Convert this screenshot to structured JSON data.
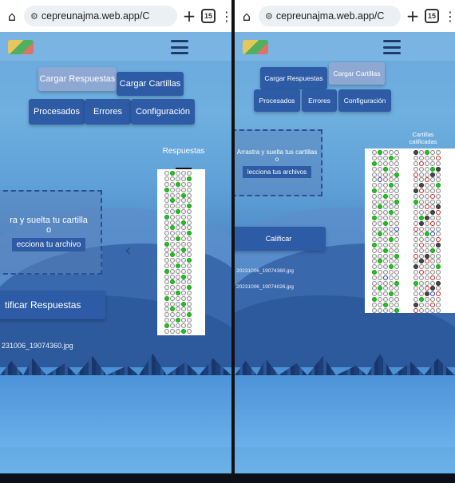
{
  "browser_left": {
    "url": "cepreunajma.web.app/C",
    "tab_count": "15"
  },
  "browser_right": {
    "url": "cepreunajma.web.app/C",
    "tab_count": "15"
  },
  "icons": {
    "home": "home-icon",
    "tune": "site-settings-icon",
    "plus": "new-tab-icon",
    "tabs": "tab-switcher-icon",
    "menu": "overflow-menu-icon",
    "hamburger": "hamburger-menu-icon"
  },
  "left": {
    "nav": {
      "cargar_respuestas": "Cargar Respuestas",
      "cargar_cartillas": "Cargar Cartillas",
      "procesados": "Procesados",
      "errores": "Errores",
      "configuracion": "Configuración"
    },
    "respuestas_title": "Respuestas",
    "dropzone": {
      "text": "ra y suelta tu cartilla",
      "or": "o",
      "button": "ecciona tu archivo"
    },
    "action_button": "tificar Respuestas",
    "file": "231006_19074360.jpg"
  },
  "right": {
    "nav": {
      "cargar_respuestas": "Cargar Respuestas",
      "cargar_cartillas": "Cargar Cartillas",
      "procesados": "Procesados",
      "errores": "Errores",
      "configuracion": "Configuración"
    },
    "cartillas_title": "Cartillas calificadas",
    "dropzone": {
      "text": "Arrastra y suelta tus cartillas",
      "or": "o",
      "button": "lecciona tus archivos"
    },
    "action_button": "Calificar",
    "files": [
      "20231006_19074360.jpg",
      "20231006_19074026.jpg"
    ]
  },
  "colors": {
    "button": "#2d5ba6",
    "active_button": "#8ea7d3",
    "correct": "#22c422",
    "wrong": "#d0201e",
    "marked": "#2635c7"
  }
}
